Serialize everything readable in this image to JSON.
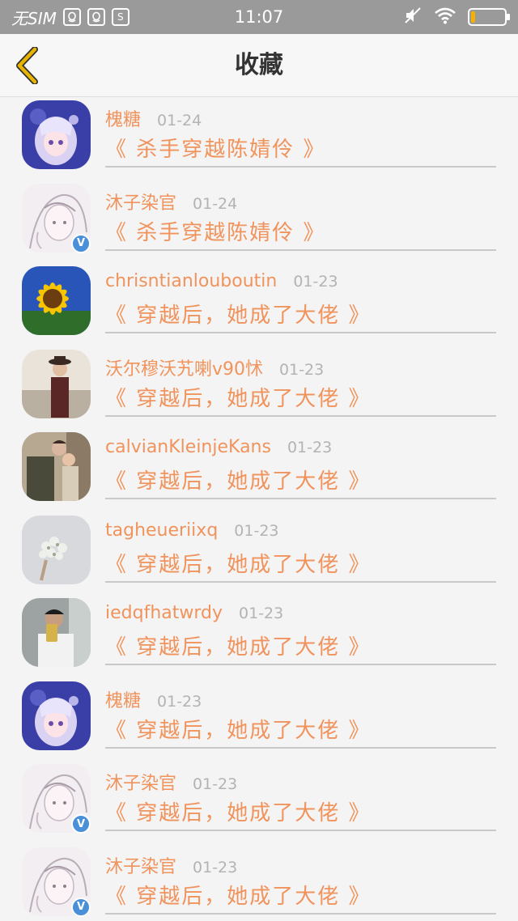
{
  "status_bar": {
    "carrier": "无SIM",
    "icons": [
      "qq-icon",
      "qq-icon",
      "s-icon"
    ],
    "time": "11:07",
    "right_icons": [
      "mute-icon",
      "wifi-icon",
      "battery-icon"
    ],
    "battery_level": 0.12
  },
  "nav": {
    "title": "收藏"
  },
  "favorites": [
    {
      "username": "槐糖",
      "date": "01-24",
      "title": "《 杀手穿越陈婧伶 》",
      "avatar": "anime-girl",
      "verified": false
    },
    {
      "username": "沐子染官",
      "date": "01-24",
      "title": "《 杀手穿越陈婧伶 》",
      "avatar": "sketch-girl",
      "verified": true
    },
    {
      "username": "chrisntianlouboutin",
      "date": "01-23",
      "title": "《 穿越后，她成了大佬 》",
      "avatar": "sunflower",
      "verified": false
    },
    {
      "username": "沃尔穆沃艽喇v90怵",
      "date": "01-23",
      "title": "《 穿越后，她成了大佬 》",
      "avatar": "man-hat",
      "verified": false
    },
    {
      "username": "calvianKleinjeKans",
      "date": "01-23",
      "title": "《 穿越后，她成了大佬 》",
      "avatar": "couple",
      "verified": false
    },
    {
      "username": "tagheueriixq",
      "date": "01-23",
      "title": "《 穿越后，她成了大佬 》",
      "avatar": "flowers",
      "verified": false
    },
    {
      "username": "iedqfhatwrdy",
      "date": "01-23",
      "title": "《 穿越后，她成了大佬 》",
      "avatar": "selfie-man",
      "verified": false
    },
    {
      "username": "槐糖",
      "date": "01-23",
      "title": "《 穿越后，她成了大佬 》",
      "avatar": "anime-girl",
      "verified": false
    },
    {
      "username": "沐子染官",
      "date": "01-23",
      "title": "《 穿越后，她成了大佬 》",
      "avatar": "sketch-girl",
      "verified": true
    },
    {
      "username": "沐子染官",
      "date": "01-23",
      "title": "《 穿越后，她成了大佬 》",
      "avatar": "sketch-girl",
      "verified": true
    }
  ],
  "colors": {
    "accent": "#f0935c",
    "date": "#b3b3b3",
    "status_bar": "#9a9a9a",
    "verified": "#4a90d9",
    "back_arrow": "#e8b400"
  }
}
